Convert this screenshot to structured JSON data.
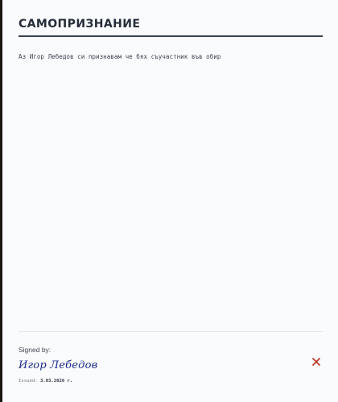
{
  "document": {
    "title": "САМОПРИЗНАНИЕ",
    "body": "Аз Игор Лебедов си признавам че бях съучастник във обир"
  },
  "footer": {
    "signed_by_label": "Signed by:",
    "signature": "Игор Лебедов",
    "issued_label": "Issued:",
    "issued_date": "3.03.2026 г."
  },
  "icons": {
    "close": "close-icon"
  },
  "colors": {
    "close": "#c0392b",
    "signature_ink": "#1b2a8c",
    "title": "#262d3a"
  }
}
